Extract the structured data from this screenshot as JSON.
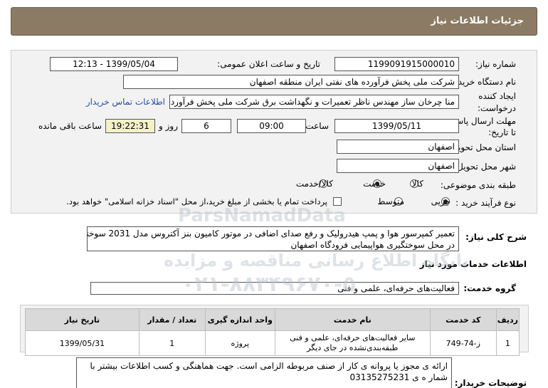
{
  "header": {
    "title": "جزئیات اطلاعات نیاز"
  },
  "form": {
    "need_number_label": "شماره نیاز:",
    "need_number": "1199091915000010",
    "announce_label": "تاریخ و ساعت اعلان عمومی:",
    "announce_value": "1399/05/04 - 12:13",
    "buyer_label": "نام دستگاه خریدار:",
    "buyer_value": "شرکت ملی پخش فرآورده های نفتی ایران منطقه اصفهان",
    "requester_label_1": "ایجاد کننده",
    "requester_label_2": "درخواست:",
    "requester_value": "منا چرخان ساز مهندس ناظر تعمیرات و نگهداشت برق شرکت ملی پخش فرآورد",
    "contact_link": "اطلاعات تماس خریدار",
    "deadline_label_1": "مهلت ارسال پاسخ:",
    "deadline_label_2": "تا تاریخ:",
    "deadline_date": "1399/05/11",
    "time_label": "ساعت",
    "deadline_time": "09:00",
    "days_value": "6",
    "days_label": "روز و",
    "remaining_time": "19:22:31",
    "remaining_label": "ساعت باقی مانده",
    "province_label": "استان محل تحویل:",
    "province_value": "اصفهان",
    "city_label": "شهر محل تحویل:",
    "city_value": "اصفهان",
    "category_label": "طبقه بندی موضوعی:",
    "category_options": [
      "کالا",
      "خدمت",
      "کالا/خدمت"
    ],
    "category_selected": "خدمت",
    "process_label": "نوع فرآیند خرید :",
    "process_options": [
      "جزیی",
      "متوسط"
    ],
    "process_selected": "جزیی",
    "payment_note": "پرداخت تمام یا بخشی از مبلغ خرید،از محل \"اسناد خزانه اسلامی\" خواهد بود."
  },
  "description": {
    "label": "شرح کلی نیاز:",
    "line1": "تعمیر کمپرسور هوا و پمپ هیدرولیک و رفع صدای اضافی در موتور کامیون بنز آکتروس مدل 2031 سوخترسان",
    "line2": "در محل سوختگیری هواپیمایی فرودگاه اصفهان"
  },
  "services": {
    "section_title": "اطلاعات خدمات مورد نیاز",
    "group_label": "گروه خدمت:",
    "group_value": "فعالیت‌های حرفه‌ای، علمی و فنی",
    "columns": [
      "ردیف",
      "کد خدمت",
      "نام خدمت",
      "واحد اندازه گیری",
      "تعداد / مقدار",
      "تاریخ نیاز"
    ],
    "rows": [
      {
        "index": "1",
        "code": "ز-74-749",
        "name": "سایر فعالیت‌های حرفه‌ای، علمی و فنی طبقه‌بندی‌نشده در جای دیگر",
        "unit": "پروژه",
        "qty": "1",
        "date": "1399/05/31"
      }
    ]
  },
  "notes": {
    "label": "توضیحات خریدار:",
    "line1": "ارائه ی مجوز یا پروانه ی کار از صنف مربوطه الزامی است. جهت هماهنگی و کسب اطلاعات بیشتر با",
    "line2": "شمار ه ی 03135275231"
  },
  "watermark": {
    "line1": "ParsNamadData",
    "line2": "پایگاه اطلاع رسانی مناقصه و مزایده",
    "line3": "۰۲۱-۸۸۳۴۹۶۷۰-۵"
  }
}
